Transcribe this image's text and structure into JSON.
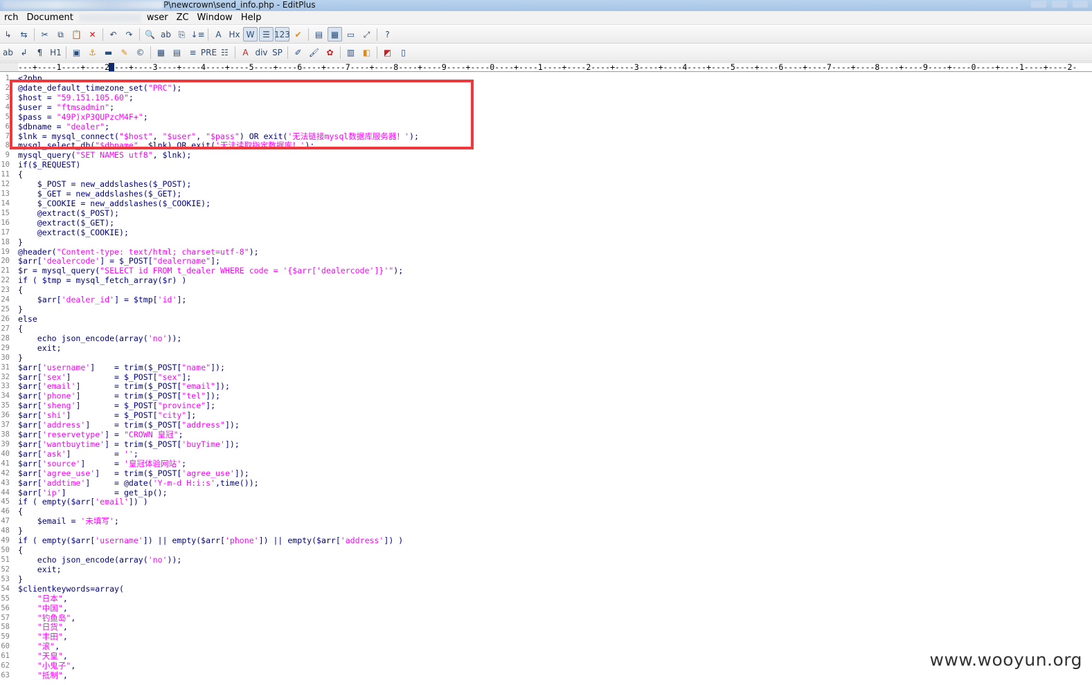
{
  "window": {
    "title_visible": "P\\newcrown\\send_info.php - EditPlus"
  },
  "menubar": {
    "items": [
      {
        "label": "rch",
        "blur_after": false
      },
      {
        "label": "Document",
        "blur_after": true
      },
      {
        "label": "wser",
        "blur_after": false
      },
      {
        "label": "ZC",
        "blur_after": false
      },
      {
        "label": "Window",
        "blur_after": false
      },
      {
        "label": "Help",
        "blur_after": false
      }
    ]
  },
  "toolbar1": {
    "buttons": [
      {
        "icon": "arrow-icon",
        "glyph": "↳"
      },
      {
        "icon": "window-switch-icon",
        "glyph": "⇆"
      },
      {
        "sep": true
      },
      {
        "icon": "cut-icon",
        "glyph": "✂"
      },
      {
        "icon": "copy-icon",
        "glyph": "⧉"
      },
      {
        "icon": "paste-icon",
        "glyph": "📋"
      },
      {
        "icon": "delete-icon",
        "glyph": "✕",
        "cls": "red"
      },
      {
        "sep": true
      },
      {
        "icon": "undo-icon",
        "glyph": "↶"
      },
      {
        "icon": "redo-icon",
        "glyph": "↷"
      },
      {
        "sep": true
      },
      {
        "icon": "find-icon",
        "glyph": "🔍"
      },
      {
        "icon": "replace-icon",
        "glyph": "ab"
      },
      {
        "icon": "find-in-files-icon",
        "glyph": "⎘"
      },
      {
        "icon": "goto-line-icon",
        "glyph": "↓≡"
      },
      {
        "sep": true
      },
      {
        "icon": "font-icon",
        "glyph": "A"
      },
      {
        "icon": "hex-icon",
        "glyph": "Hx"
      },
      {
        "icon": "word-wrap-icon",
        "glyph": "W",
        "pressed": true
      },
      {
        "icon": "ruler-toggle-icon",
        "glyph": "☰",
        "pressed": true
      },
      {
        "icon": "line-number-icon",
        "glyph": "123",
        "pressed": true
      },
      {
        "icon": "spellcheck-icon",
        "glyph": "✔",
        "cls": "orange"
      },
      {
        "sep": true
      },
      {
        "icon": "cliptext-icon",
        "glyph": "▤"
      },
      {
        "icon": "directory-icon",
        "glyph": "▦",
        "pressed": true
      },
      {
        "icon": "output-window-icon",
        "glyph": "▭"
      },
      {
        "icon": "fullscreen-icon",
        "glyph": "⤢"
      },
      {
        "sep": true
      },
      {
        "icon": "help-icon",
        "glyph": "?"
      }
    ]
  },
  "toolbar2": {
    "buttons": [
      {
        "icon": "bold-icon",
        "glyph": "ab"
      },
      {
        "icon": "line-break-icon",
        "glyph": "↲"
      },
      {
        "icon": "paragraph-icon",
        "glyph": "¶"
      },
      {
        "icon": "heading-icon",
        "glyph": "H1"
      },
      {
        "sep": true
      },
      {
        "icon": "image-icon",
        "glyph": "▣"
      },
      {
        "icon": "anchor-icon",
        "glyph": "⚓",
        "cls": "orange"
      },
      {
        "icon": "hr-icon",
        "glyph": "▬"
      },
      {
        "icon": "highlight-icon",
        "glyph": "✎",
        "cls": "orange"
      },
      {
        "icon": "copyright-icon",
        "glyph": "©"
      },
      {
        "sep": true
      },
      {
        "icon": "table-icon",
        "glyph": "▦"
      },
      {
        "icon": "form-icon",
        "glyph": "▤"
      },
      {
        "icon": "center-icon",
        "glyph": "≡"
      },
      {
        "icon": "pre-icon",
        "glyph": "PRE"
      },
      {
        "icon": "list-icon",
        "glyph": "☷"
      },
      {
        "sep": true
      },
      {
        "icon": "font-tag-icon",
        "glyph": "A",
        "cls": "red"
      },
      {
        "icon": "div-icon",
        "glyph": "div"
      },
      {
        "icon": "span-icon",
        "glyph": "SP"
      },
      {
        "sep": true
      },
      {
        "icon": "edit-icon",
        "glyph": "✐"
      },
      {
        "icon": "paint-icon",
        "glyph": "🖌"
      },
      {
        "icon": "color-icon",
        "glyph": "✿",
        "cls": "red"
      },
      {
        "sep": true
      },
      {
        "icon": "frame-icon",
        "glyph": "▥"
      },
      {
        "icon": "preview-icon",
        "glyph": "◧",
        "cls": "orange"
      },
      {
        "sep": true
      },
      {
        "icon": "browser-icon",
        "glyph": "◩",
        "cls": "red"
      },
      {
        "icon": "view-icon",
        "glyph": "▯"
      }
    ]
  },
  "ruler": {
    "text": "---+----1----+----2----+----3----+----4----+----5----+----6----+----7----+----8----+----9----+----0----+----1----+----2----+----3----+----4----+----5----+----6----+----7----+----8----+----9----+----0----+----1----+----2-"
  },
  "code_lines": [
    {
      "n": "1",
      "parts": [
        [
          "c",
          "<?php"
        ]
      ]
    },
    {
      "n": "2",
      "parts": [
        [
          "c",
          "@date_default_timezone_set("
        ],
        [
          "s",
          "\"PRC\""
        ],
        [
          "c",
          ");"
        ]
      ]
    },
    {
      "n": "3",
      "parts": [
        [
          "c",
          "$host = "
        ],
        [
          "s",
          "\"59.151.105.60\""
        ],
        [
          "c",
          ";"
        ]
      ]
    },
    {
      "n": "4",
      "parts": [
        [
          "c",
          "$user = "
        ],
        [
          "s",
          "\"ftmsadmin\""
        ],
        [
          "c",
          ";"
        ]
      ]
    },
    {
      "n": "5",
      "parts": [
        [
          "c",
          "$pass = "
        ],
        [
          "s",
          "\"49P)xP3QUPzcM4F+\""
        ],
        [
          "c",
          ";"
        ]
      ]
    },
    {
      "n": "6",
      "parts": [
        [
          "c",
          "$dbname = "
        ],
        [
          "s",
          "\"dealer\""
        ],
        [
          "c",
          ";"
        ]
      ]
    },
    {
      "n": "7",
      "parts": [
        [
          "c",
          "$lnk = mysql_connect("
        ],
        [
          "s",
          "\"$host\""
        ],
        [
          "c",
          ", "
        ],
        [
          "s",
          "\"$user\""
        ],
        [
          "c",
          ", "
        ],
        [
          "s",
          "\"$pass\""
        ],
        [
          "c",
          ") OR exit("
        ],
        [
          "s",
          "'无法链接mysql数据库服务器！'"
        ],
        [
          "c",
          ");"
        ]
      ]
    },
    {
      "n": "8",
      "parts": [
        [
          "c",
          "mysql_select_db("
        ],
        [
          "s",
          "\"$dbname\""
        ],
        [
          "c",
          ", $lnk) OR exit("
        ],
        [
          "s",
          "'无法读取指定数据库！'"
        ],
        [
          "c",
          ");"
        ]
      ]
    },
    {
      "n": "9",
      "parts": [
        [
          "c",
          "mysql_query("
        ],
        [
          "s",
          "\"SET NAMES utf8\""
        ],
        [
          "c",
          ", $lnk);"
        ]
      ]
    },
    {
      "n": "10",
      "parts": [
        [
          "c",
          "if($_REQUEST)"
        ]
      ]
    },
    {
      "n": "11",
      "parts": [
        [
          "c",
          "{"
        ]
      ]
    },
    {
      "n": "12",
      "parts": [
        [
          "c",
          "    $_POST = new_addslashes($_POST);"
        ]
      ]
    },
    {
      "n": "13",
      "parts": [
        [
          "c",
          "    $_GET = new_addslashes($_GET);"
        ]
      ]
    },
    {
      "n": "14",
      "parts": [
        [
          "c",
          "    $_COOKIE = new_addslashes($_COOKIE);"
        ]
      ]
    },
    {
      "n": "15",
      "parts": [
        [
          "c",
          "    @extract($_POST);"
        ]
      ]
    },
    {
      "n": "16",
      "parts": [
        [
          "c",
          "    @extract($_GET);"
        ]
      ]
    },
    {
      "n": "17",
      "parts": [
        [
          "c",
          "    @extract($_COOKIE);"
        ]
      ]
    },
    {
      "n": "18",
      "parts": [
        [
          "c",
          "}"
        ]
      ]
    },
    {
      "n": "19",
      "parts": [
        [
          "c",
          "@header("
        ],
        [
          "s",
          "\"Content-type: text/html; charset=utf-8\""
        ],
        [
          "c",
          ");"
        ]
      ]
    },
    {
      "n": "20",
      "parts": [
        [
          "c",
          "$arr["
        ],
        [
          "s",
          "'dealercode'"
        ],
        [
          "c",
          "] = $_POST["
        ],
        [
          "s",
          "\"dealername\""
        ],
        [
          "c",
          "];"
        ]
      ]
    },
    {
      "n": "21",
      "parts": [
        [
          "c",
          "$r = mysql_query("
        ],
        [
          "s",
          "\"SELECT id FROM t_dealer WHERE code = '{$arr['dealercode']}'\""
        ],
        [
          "c",
          ");"
        ]
      ]
    },
    {
      "n": "22",
      "parts": [
        [
          "c",
          "if ( $tmp = mysql_fetch_array($r) )"
        ]
      ]
    },
    {
      "n": "23",
      "parts": [
        [
          "c",
          "{"
        ]
      ]
    },
    {
      "n": "24",
      "parts": [
        [
          "c",
          "    $arr["
        ],
        [
          "s",
          "'dealer_id'"
        ],
        [
          "c",
          "] = $tmp["
        ],
        [
          "s",
          "'id'"
        ],
        [
          "c",
          "];"
        ]
      ]
    },
    {
      "n": "25",
      "parts": [
        [
          "c",
          "}"
        ]
      ]
    },
    {
      "n": "26",
      "parts": [
        [
          "c",
          "else"
        ]
      ]
    },
    {
      "n": "27",
      "parts": [
        [
          "c",
          "{"
        ]
      ]
    },
    {
      "n": "28",
      "parts": [
        [
          "c",
          "    echo json_encode(array("
        ],
        [
          "s",
          "'no'"
        ],
        [
          "c",
          "));"
        ]
      ]
    },
    {
      "n": "29",
      "parts": [
        [
          "c",
          "    exit;"
        ]
      ]
    },
    {
      "n": "30",
      "parts": [
        [
          "c",
          "}"
        ]
      ]
    },
    {
      "n": "31",
      "parts": [
        [
          "c",
          "$arr["
        ],
        [
          "s",
          "'username'"
        ],
        [
          "c",
          "]    = trim($_POST["
        ],
        [
          "s",
          "\"name\""
        ],
        [
          "c",
          "]);"
        ]
      ]
    },
    {
      "n": "32",
      "parts": [
        [
          "c",
          "$arr["
        ],
        [
          "s",
          "'sex'"
        ],
        [
          "c",
          "]         = $_POST["
        ],
        [
          "s",
          "\"sex\""
        ],
        [
          "c",
          "];"
        ]
      ]
    },
    {
      "n": "33",
      "parts": [
        [
          "c",
          "$arr["
        ],
        [
          "s",
          "'email'"
        ],
        [
          "c",
          "]       = trim($_POST["
        ],
        [
          "s",
          "\"email\""
        ],
        [
          "c",
          "]);"
        ]
      ]
    },
    {
      "n": "34",
      "parts": [
        [
          "c",
          "$arr["
        ],
        [
          "s",
          "'phone'"
        ],
        [
          "c",
          "]       = trim($_POST["
        ],
        [
          "s",
          "\"tel\""
        ],
        [
          "c",
          "]);"
        ]
      ]
    },
    {
      "n": "35",
      "parts": [
        [
          "c",
          "$arr["
        ],
        [
          "s",
          "'sheng'"
        ],
        [
          "c",
          "]       = $_POST["
        ],
        [
          "s",
          "\"province\""
        ],
        [
          "c",
          "];"
        ]
      ]
    },
    {
      "n": "36",
      "parts": [
        [
          "c",
          "$arr["
        ],
        [
          "s",
          "'shi'"
        ],
        [
          "c",
          "]         = $_POST["
        ],
        [
          "s",
          "\"city\""
        ],
        [
          "c",
          "];"
        ]
      ]
    },
    {
      "n": "37",
      "parts": [
        [
          "c",
          "$arr["
        ],
        [
          "s",
          "'address'"
        ],
        [
          "c",
          "]     = trim($_POST["
        ],
        [
          "s",
          "\"address\""
        ],
        [
          "c",
          "]);"
        ]
      ]
    },
    {
      "n": "38",
      "parts": [
        [
          "c",
          "$arr["
        ],
        [
          "s",
          "'reservetype'"
        ],
        [
          "c",
          "] = "
        ],
        [
          "s",
          "\"CROWN 皇冠\""
        ],
        [
          "c",
          ";"
        ]
      ]
    },
    {
      "n": "39",
      "parts": [
        [
          "c",
          "$arr["
        ],
        [
          "s",
          "'wantbuytime'"
        ],
        [
          "c",
          "] = trim($_POST["
        ],
        [
          "s",
          "'buyTime'"
        ],
        [
          "c",
          "]);"
        ]
      ]
    },
    {
      "n": "40",
      "parts": [
        [
          "c",
          "$arr["
        ],
        [
          "s",
          "'ask'"
        ],
        [
          "c",
          "]         = "
        ],
        [
          "s",
          "''"
        ],
        [
          "c",
          ";"
        ]
      ]
    },
    {
      "n": "41",
      "parts": [
        [
          "c",
          "$arr["
        ],
        [
          "s",
          "'source'"
        ],
        [
          "c",
          "]      = "
        ],
        [
          "s",
          "'皇冠体验网站'"
        ],
        [
          "c",
          ";"
        ]
      ]
    },
    {
      "n": "42",
      "parts": [
        [
          "c",
          "$arr["
        ],
        [
          "s",
          "'agree_use'"
        ],
        [
          "c",
          "]   = trim($_POST["
        ],
        [
          "s",
          "'agree_use'"
        ],
        [
          "c",
          "]);"
        ]
      ]
    },
    {
      "n": "43",
      "parts": [
        [
          "c",
          "$arr["
        ],
        [
          "s",
          "'addtime'"
        ],
        [
          "c",
          "]     = @date("
        ],
        [
          "s",
          "'Y-m-d H:i:s'"
        ],
        [
          "c",
          ",time());"
        ]
      ]
    },
    {
      "n": "44",
      "parts": [
        [
          "c",
          "$arr["
        ],
        [
          "s",
          "'ip'"
        ],
        [
          "c",
          "]          = get_ip();"
        ]
      ]
    },
    {
      "n": "45",
      "parts": [
        [
          "c",
          "if ( empty($arr["
        ],
        [
          "s",
          "'email'"
        ],
        [
          "c",
          "]) )"
        ]
      ]
    },
    {
      "n": "46",
      "parts": [
        [
          "c",
          "{"
        ]
      ]
    },
    {
      "n": "47",
      "parts": [
        [
          "c",
          "    $email = "
        ],
        [
          "s",
          "'未填写'"
        ],
        [
          "c",
          ";"
        ]
      ]
    },
    {
      "n": "48",
      "parts": [
        [
          "c",
          "}"
        ]
      ]
    },
    {
      "n": "49",
      "parts": [
        [
          "c",
          "if ( empty($arr["
        ],
        [
          "s",
          "'username'"
        ],
        [
          "c",
          "]) || empty($arr["
        ],
        [
          "s",
          "'phone'"
        ],
        [
          "c",
          "]) || empty($arr["
        ],
        [
          "s",
          "'address'"
        ],
        [
          "c",
          "]) )"
        ]
      ]
    },
    {
      "n": "50",
      "parts": [
        [
          "c",
          "{"
        ]
      ]
    },
    {
      "n": "51",
      "parts": [
        [
          "c",
          "    echo json_encode(array("
        ],
        [
          "s",
          "'no'"
        ],
        [
          "c",
          "));"
        ]
      ]
    },
    {
      "n": "52",
      "parts": [
        [
          "c",
          "    exit;"
        ]
      ]
    },
    {
      "n": "53",
      "parts": [
        [
          "c",
          "}"
        ]
      ]
    },
    {
      "n": "54",
      "parts": [
        [
          "c",
          "$clientkeywords=array("
        ]
      ]
    },
    {
      "n": "55",
      "parts": [
        [
          "s",
          "    \"日本\""
        ],
        [
          "c",
          ","
        ]
      ]
    },
    {
      "n": "56",
      "parts": [
        [
          "s",
          "    \"中国\""
        ],
        [
          "c",
          ","
        ]
      ]
    },
    {
      "n": "57",
      "parts": [
        [
          "s",
          "    \"钓鱼岛\""
        ],
        [
          "c",
          ","
        ]
      ]
    },
    {
      "n": "58",
      "parts": [
        [
          "s",
          "    \"日货\""
        ],
        [
          "c",
          ","
        ]
      ]
    },
    {
      "n": "59",
      "parts": [
        [
          "s",
          "    \"丰田\""
        ],
        [
          "c",
          ","
        ]
      ]
    },
    {
      "n": "60",
      "parts": [
        [
          "s",
          "    \"滚\""
        ],
        [
          "c",
          ","
        ]
      ]
    },
    {
      "n": "61",
      "parts": [
        [
          "s",
          "    \"天皇\""
        ],
        [
          "c",
          ","
        ]
      ]
    },
    {
      "n": "62",
      "parts": [
        [
          "s",
          "    \"小鬼子\""
        ],
        [
          "c",
          ","
        ]
      ]
    },
    {
      "n": "63",
      "parts": [
        [
          "s",
          "    \"抵制\""
        ],
        [
          "c",
          ","
        ]
      ]
    }
  ],
  "watermark": "www.wooyun.org"
}
